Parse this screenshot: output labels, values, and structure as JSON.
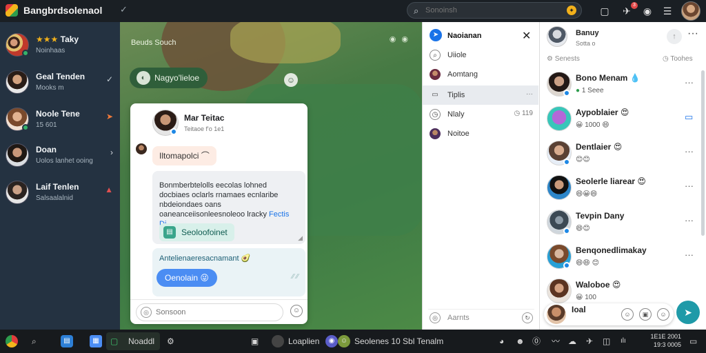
{
  "titlebar": {
    "app_title": "Bangbrdsolenaol",
    "search_placeholder": "Sonoinsh",
    "notification_count": "3"
  },
  "left_conversations": [
    {
      "name": "Taky",
      "rating_stars": "★★★",
      "sub": "Noinhaas",
      "accent": "#f2b11b",
      "right_icon": ""
    },
    {
      "name": "Geal Tenden",
      "sub": "Mooks m",
      "accent": "",
      "right_icon": "✓"
    },
    {
      "name": "Noole Tene",
      "sub": "15 601",
      "accent": "#f07a3a",
      "right_icon": "➤"
    },
    {
      "name": "Doan",
      "sub": "Uolos lanhet ooing",
      "accent": "",
      "right_icon": "›"
    },
    {
      "name": "Laif Tenlen",
      "sub": "Salsaalalnid",
      "accent": "#e05050",
      "right_icon": "▲"
    }
  ],
  "chat_pane": {
    "label": "Beuds Souch",
    "topic_pill": "Nagyo'lieloe"
  },
  "chat_card": {
    "contact_name": "Mar Teitac",
    "contact_sub": "Teitaoe f'o 1e1",
    "message_1": "Iltomapolci",
    "message_2_text": "Bonmberbtelolls eecolas lohned docbiaes oclarls rnamaes ecnlaribe nbdeiondaes oans oaneanceiisonleesnoleoo lracky",
    "message_2_link": "Fectis",
    "message_2_tail": "Di",
    "attachment_label": "Seoloofoinet",
    "message_3_text": "Antelienaeresacnamant",
    "reply_button": "Oenolain",
    "input_placeholder": "Sonsoon"
  },
  "mid_panel": {
    "title": "Naoianan",
    "items": [
      {
        "label": "Uiiole",
        "icon": "search-icon",
        "tail": "",
        "active": false
      },
      {
        "label": "Aomtang",
        "icon": "avatar",
        "tail": "",
        "active": false
      },
      {
        "label": "Tiplis",
        "icon": "calendar-icon",
        "tail": "···",
        "active": true
      },
      {
        "label": "Nlaly",
        "icon": "clock-icon",
        "tail": "◷ 119",
        "active": false
      },
      {
        "label": "Noitoe",
        "icon": "avatar",
        "tail": "",
        "active": false
      }
    ],
    "footer_label": "Aarnts"
  },
  "right_panel": {
    "header_name": "Banuy",
    "header_sub": "Sotta o",
    "section_left": "Senests",
    "section_right": "Toohes",
    "people": [
      {
        "name": "Bono Menam",
        "reaction": "1 Seee",
        "verified": true
      },
      {
        "name": "Aypoblaier",
        "reaction": "1000",
        "verified": false
      },
      {
        "name": "Dentlaier",
        "reaction": "😊😊",
        "verified": true
      },
      {
        "name": "Seolerle liarear",
        "reaction": "😄😀😄",
        "verified": false
      },
      {
        "name": "Tevpin Dany",
        "reaction": "😄😊",
        "verified": true
      },
      {
        "name": "Benqonedlimakay",
        "reaction": "😄😄 😊",
        "verified": true
      },
      {
        "name": "Waloboe",
        "reaction": "100",
        "verified": false
      },
      {
        "name": "Ioal",
        "reaction": "",
        "verified": false
      }
    ]
  },
  "taskbar": {
    "active_app": "Noaddl",
    "task_1": "Loaplien",
    "task_2": "Seolenes 10 Sbl Tenalm",
    "time_1": "1E1E 2001",
    "time_2": "19:3 0005"
  },
  "colors": {
    "accent_blue": "#1a73e8",
    "send_button": "#1f9aa8",
    "reply_button": "#4b8df3"
  }
}
